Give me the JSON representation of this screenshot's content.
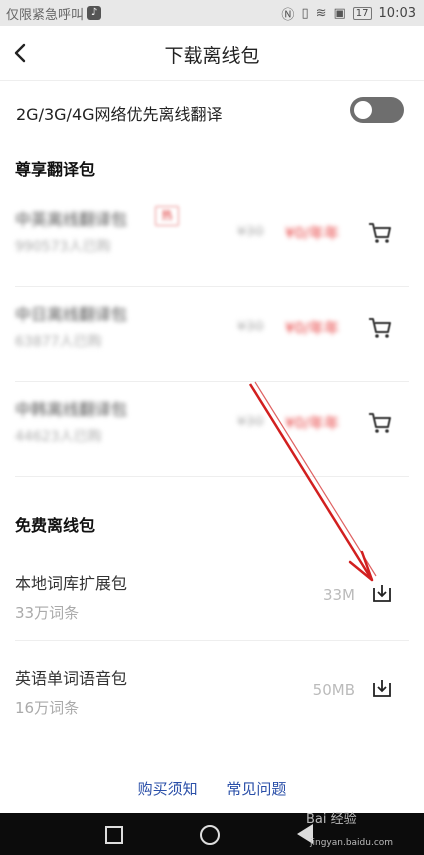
{
  "status_bar": {
    "left_text": "仅限紧急呼叫",
    "battery": "17",
    "time": "10:03"
  },
  "header": {
    "title": "下载离线包"
  },
  "settings": {
    "network_pref_label": "2G/3G/4G网络优先离线翻译",
    "network_pref_enabled": false
  },
  "sections": {
    "premium_title": "尊享翻译包",
    "free_title": "免费离线包"
  },
  "premium_packs": [
    {
      "name": "中英离线翻译包",
      "buyers": "990573人已购",
      "tag": "热",
      "old_price": "¥30",
      "new_price": "¥0/年年"
    },
    {
      "name": "中日离线翻译包",
      "buyers": "63877人已购",
      "old_price": "¥30",
      "new_price": "¥0/年年"
    },
    {
      "name": "中韩离线翻译包",
      "buyers": "44623人已购",
      "old_price": "¥30",
      "new_price": "¥0/年年"
    }
  ],
  "free_packs": [
    {
      "name": "本地词库扩展包",
      "entries": "33万词条",
      "size": "33M"
    },
    {
      "name": "英语单词语音包",
      "entries": "16万词条",
      "size": "50MB"
    }
  ],
  "footer": {
    "purchase_notice": "购买须知",
    "faq": "常见问题"
  },
  "watermark": {
    "brand": "Bai 经验",
    "url": "jingyan.baidu.com"
  },
  "colors": {
    "link": "#2a4fa8",
    "price": "#e63b3b",
    "arrow": "#d21f1f"
  }
}
